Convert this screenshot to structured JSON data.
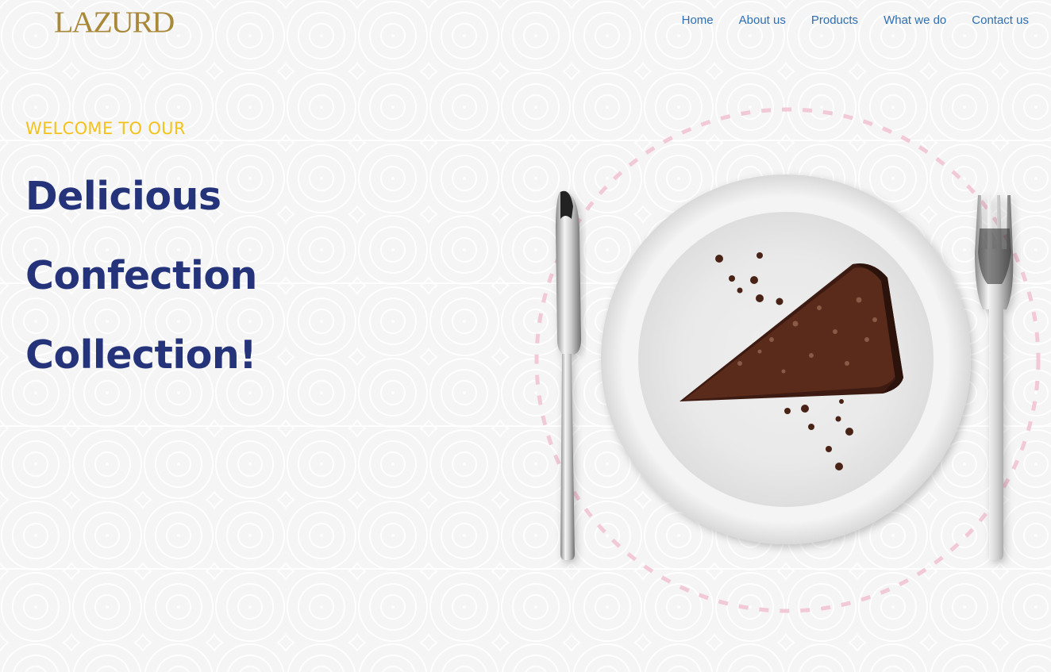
{
  "brand": {
    "logo_text": "LAZURD"
  },
  "nav": {
    "items": [
      {
        "label": "Home"
      },
      {
        "label": "About us"
      },
      {
        "label": "Products"
      },
      {
        "label": "What we do"
      },
      {
        "label": "Contact us"
      }
    ]
  },
  "hero": {
    "eyebrow": "WELCOME TO OUR",
    "headline_lines": [
      "Delicious",
      "Confection",
      "Collection!"
    ],
    "image": "plate-with-chocolate-cake-slice-and-cutlery"
  },
  "colors": {
    "logo": "#a8893a",
    "nav_link": "#2f6fb3",
    "eyebrow": "#f4c21a",
    "headline": "#24337a",
    "dashed_circle": "#f2c9d6",
    "cake": "#4a2317"
  }
}
